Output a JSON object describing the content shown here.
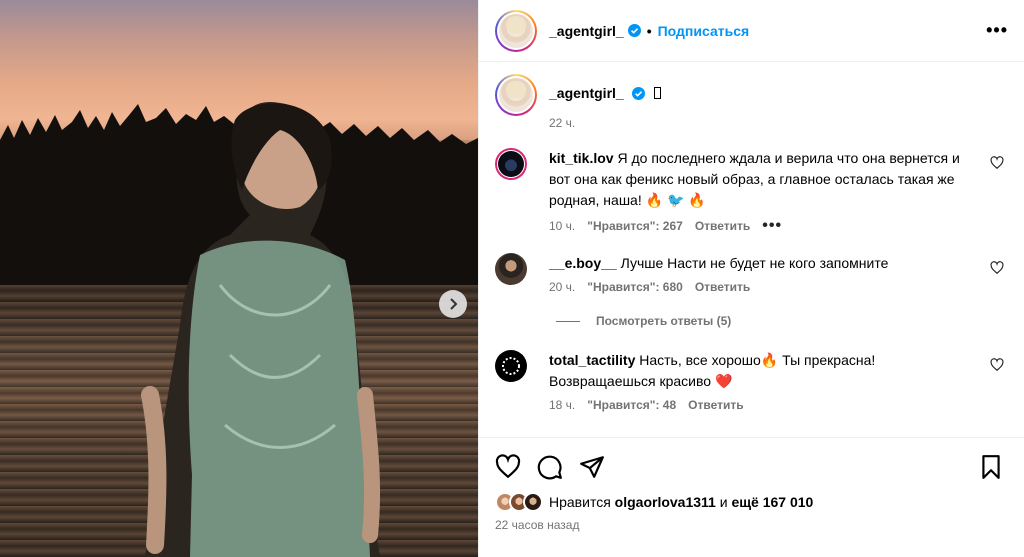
{
  "post": {
    "author": "_agentgirl_",
    "follow_label": "Подписаться",
    "separator": "•",
    "more_label": "•••"
  },
  "caption": {
    "author": "_agentgirl_",
    "time": "22 ч."
  },
  "comments": [
    {
      "user": "kit_tik.lov",
      "text": "Я до последнего ждала и верила что она вернется и вот она как феникс новый образ, а главное осталась такая же родная, наша! 🔥 🐦 🔥",
      "time": "10 ч.",
      "likes": "\"Нравится\": 267",
      "reply": "Ответить",
      "more": "•••"
    },
    {
      "user": "__e.boy__",
      "text": "Лучше Насти не будет не кого запомните",
      "time": "20 ч.",
      "likes": "\"Нравится\": 680",
      "reply": "Ответить"
    },
    {
      "user": "total_tactility",
      "text": "Насть, все хорошо🔥 Ты прекрасна! Возвращаешься красиво ❤️",
      "time": "18 ч.",
      "likes": "\"Нравится\": 48",
      "reply": "Ответить"
    }
  ],
  "view_replies": "Посмотреть ответы (5)",
  "likes": {
    "prefix": "Нравится",
    "user": "olgaorlova1311",
    "middle": "и",
    "rest": "ещё 167 010"
  },
  "posted_ago": "22 часов назад",
  "icons": [
    "verified-icon",
    "more-icon",
    "heart-icon",
    "comment-icon",
    "share-icon",
    "bookmark-icon",
    "chevron-right-icon"
  ],
  "colors": {
    "accent": "#0095f6",
    "muted": "#737373",
    "border": "#efefef"
  }
}
